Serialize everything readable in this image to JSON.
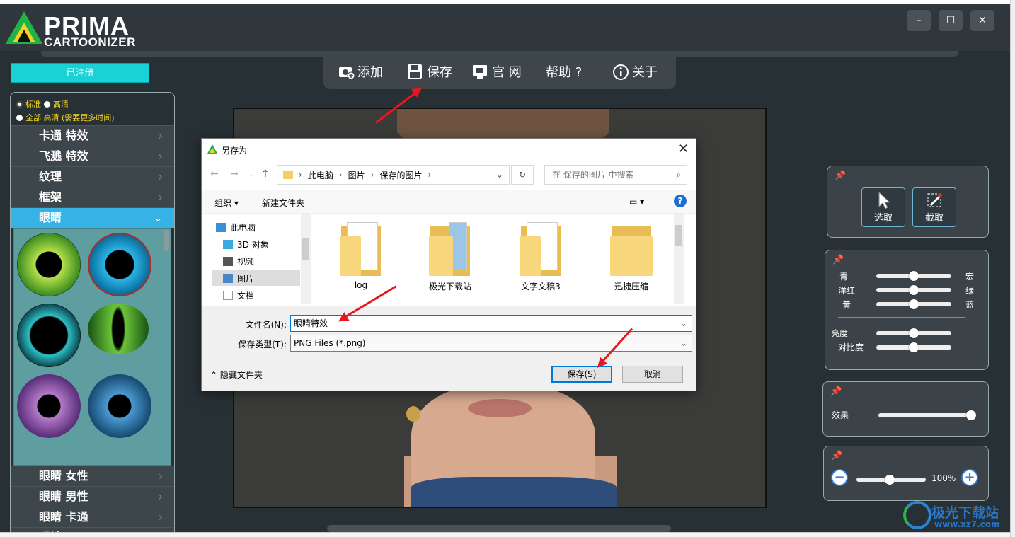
{
  "app": {
    "logo_title": "PRIMA",
    "logo_subtitle": "CARTOONIZER",
    "window_buttons": {
      "minimize": "–",
      "maximize": "☐",
      "close": "✕"
    }
  },
  "menu": {
    "add": "添加",
    "save": "保存",
    "website": "官 网",
    "help": "帮助 ?",
    "about": "关于"
  },
  "registered_label": "已注册",
  "quality": {
    "standard": "标准",
    "hd": "高清",
    "all_hd": "全部 高清 (需要更多时间)"
  },
  "categories_top": [
    "卡通 特效",
    "飞溅 特效",
    "纹理",
    "框架",
    "眼睛"
  ],
  "categories_bottom": [
    "眼睛 女性",
    "眼睛 男性",
    "眼睛 卡通",
    "眼镜"
  ],
  "right_panel": {
    "select_label": "选取",
    "crop_label": "截取",
    "sliders_left": [
      "青",
      "洋红",
      "黄"
    ],
    "sliders_right": [
      "宏",
      "绿",
      "蓝"
    ],
    "brightness": "亮度",
    "contrast": "对比度",
    "effect": "效果",
    "zoom_value": "100%"
  },
  "dialog": {
    "title": "另存为",
    "breadcrumb": [
      "此电脑",
      "图片",
      "保存的图片"
    ],
    "search_placeholder": "在 保存的图片 中搜索",
    "organize": "组织 ▾",
    "new_folder": "新建文件夹",
    "nav_items": [
      "此电脑",
      "3D 对象",
      "视频",
      "图片",
      "文档"
    ],
    "files": [
      "log",
      "极光下载站",
      "文字文稿3",
      "迅捷压缩"
    ],
    "filename_label": "文件名(N):",
    "filename_value": "眼睛特效",
    "filetype_label": "保存类型(T):",
    "filetype_value": "PNG Files (*.png)",
    "hide_folders": "隐藏文件夹",
    "save_button": "保存(S)",
    "cancel_button": "取消"
  },
  "watermark": {
    "text": "极光下载站",
    "url": "www.xz7.com"
  },
  "colors": {
    "accent_cyan": "#1ad2d6",
    "active_blue": "#35b3e6",
    "arrow_red": "#e8171b"
  }
}
